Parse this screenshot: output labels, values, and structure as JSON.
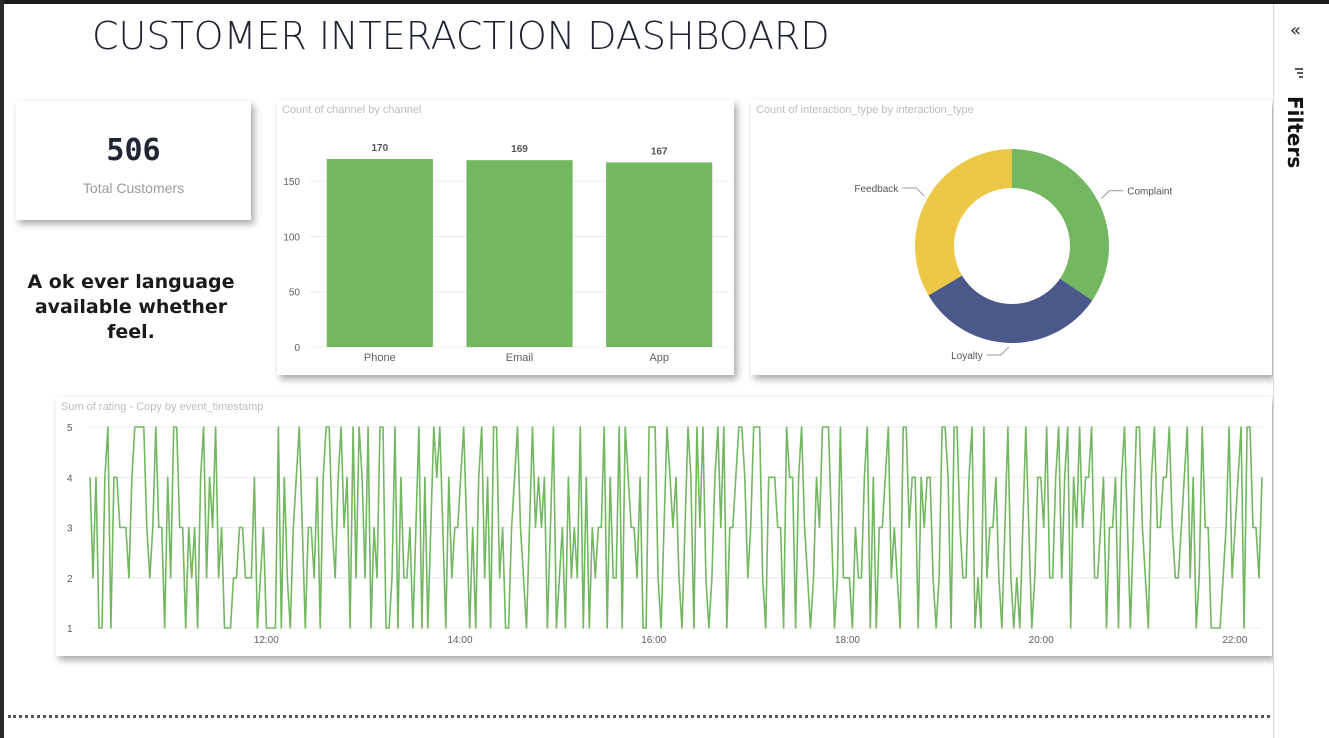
{
  "header": {
    "title": "CUSTOMER INTERACTION DASHBOARD"
  },
  "kpi": {
    "value": "506",
    "label": "Total Customers"
  },
  "note": {
    "text": "A ok ever language available whether feel."
  },
  "filters_pane": {
    "label": "Filters",
    "collapse_icon": "double-chevron-right-icon",
    "filter_icon": "filter-icon"
  },
  "colors": {
    "bar": "#73b761",
    "line": "#73b761",
    "complaint": "#73b761",
    "loyalty": "#4a588a",
    "feedback": "#ecc846",
    "axis_text": "#605e5c",
    "title_text": "#1d2233"
  },
  "chart_data": [
    {
      "type": "bar",
      "title": "Count of channel by channel",
      "categories": [
        "Phone",
        "Email",
        "App"
      ],
      "values": [
        170,
        169,
        167
      ],
      "data_labels": [
        "170",
        "169",
        "167"
      ],
      "ylim": [
        0,
        180
      ],
      "yticks": [
        "0",
        "50",
        "100",
        "150"
      ],
      "grid": true
    },
    {
      "type": "pie",
      "title": "Count of interaction_type by interaction_type",
      "donut": true,
      "categories": [
        "Complaint",
        "Loyalty",
        "Feedback"
      ],
      "values": [
        34.5,
        32.0,
        33.5
      ],
      "colors": [
        "#73b761",
        "#4a588a",
        "#ecc846"
      ]
    },
    {
      "type": "line",
      "title": "Sum of rating - Copy by event_timestamp",
      "ylim": [
        1,
        5
      ],
      "yticks": [
        "1",
        "2",
        "3",
        "4",
        "5"
      ],
      "xticks": [
        "12:00",
        "14:00",
        "16:00",
        "18:00",
        "20:00",
        "22:00"
      ],
      "x_range_hours": [
        10.18,
        22.28
      ],
      "values": [
        4,
        2,
        4,
        1,
        1,
        4,
        5,
        1,
        4,
        4,
        3,
        3,
        3,
        2,
        4,
        5,
        5,
        5,
        5,
        3,
        2,
        3,
        5,
        3,
        3,
        1,
        4,
        2,
        5,
        5,
        3,
        3,
        1,
        3,
        2,
        3,
        1,
        4,
        5,
        2,
        4,
        3,
        5,
        2,
        3,
        1,
        1,
        1,
        2,
        2,
        3,
        3,
        2,
        2,
        2,
        4,
        1,
        2,
        3,
        1,
        1,
        1,
        1,
        5,
        1,
        4,
        2,
        1,
        3,
        4,
        5,
        3,
        1,
        3,
        3,
        2,
        4,
        1,
        4,
        5,
        5,
        3,
        2,
        4,
        5,
        3,
        4,
        1,
        5,
        2,
        5,
        4,
        2,
        5,
        1,
        3,
        2,
        5,
        5,
        1,
        1,
        2,
        5,
        1,
        4,
        2,
        2,
        3,
        1,
        3,
        5,
        1,
        4,
        1,
        3,
        5,
        4,
        5,
        3,
        1,
        4,
        2,
        3,
        3,
        4,
        5,
        3,
        1,
        3,
        1,
        4,
        5,
        2,
        4,
        1,
        5,
        5,
        2,
        3,
        1,
        1,
        3,
        4,
        5,
        3,
        2,
        1,
        3,
        5,
        3,
        4,
        3,
        4,
        1,
        3,
        5,
        1,
        2,
        3,
        1,
        4,
        2,
        3,
        2,
        5,
        1,
        4,
        1,
        3,
        2,
        3,
        3,
        5,
        1,
        4,
        2,
        2,
        5,
        1,
        5,
        4,
        3,
        3,
        2,
        4,
        1,
        1,
        5,
        5,
        5,
        2,
        1,
        3,
        5,
        4,
        3,
        4,
        2,
        1,
        3,
        5,
        4,
        1,
        5,
        3,
        5,
        2,
        1,
        2,
        4,
        5,
        3,
        5,
        1,
        3,
        3,
        4,
        5,
        5,
        4,
        2,
        3,
        5,
        5,
        5,
        2,
        1,
        4,
        4,
        4,
        3,
        3,
        1,
        5,
        4,
        4,
        1,
        4,
        5,
        3,
        2,
        1,
        2,
        4,
        3,
        5,
        5,
        5,
        3,
        1,
        2,
        5,
        2,
        2,
        2,
        1,
        3,
        2,
        2,
        4,
        5,
        1,
        4,
        1,
        3,
        3,
        4,
        5,
        2,
        3,
        2,
        1,
        5,
        5,
        3,
        4,
        4,
        1,
        4,
        3,
        4,
        4,
        2,
        1,
        2,
        5,
        5,
        4,
        1,
        5,
        5,
        3,
        2,
        2,
        4,
        5,
        1,
        2,
        1,
        5,
        2,
        3,
        3,
        4,
        2,
        1,
        3,
        5,
        2,
        1,
        2,
        1,
        3,
        5,
        3,
        1,
        2,
        4,
        4,
        3,
        5,
        2,
        2,
        4,
        5,
        2,
        4,
        5,
        1,
        4,
        3,
        5,
        3,
        4,
        4,
        5,
        2,
        2,
        3,
        4,
        1,
        3,
        3,
        4,
        1,
        4,
        5,
        3,
        1,
        3,
        5,
        5,
        3,
        2,
        1,
        4,
        5,
        3,
        3,
        4,
        4,
        5,
        3,
        2,
        2,
        3,
        4,
        5,
        2,
        4,
        1,
        2,
        5,
        3,
        3,
        1,
        1,
        1,
        1,
        2,
        3,
        5,
        2,
        3,
        4,
        5,
        1,
        5,
        5,
        3,
        3,
        2,
        4
      ]
    }
  ]
}
